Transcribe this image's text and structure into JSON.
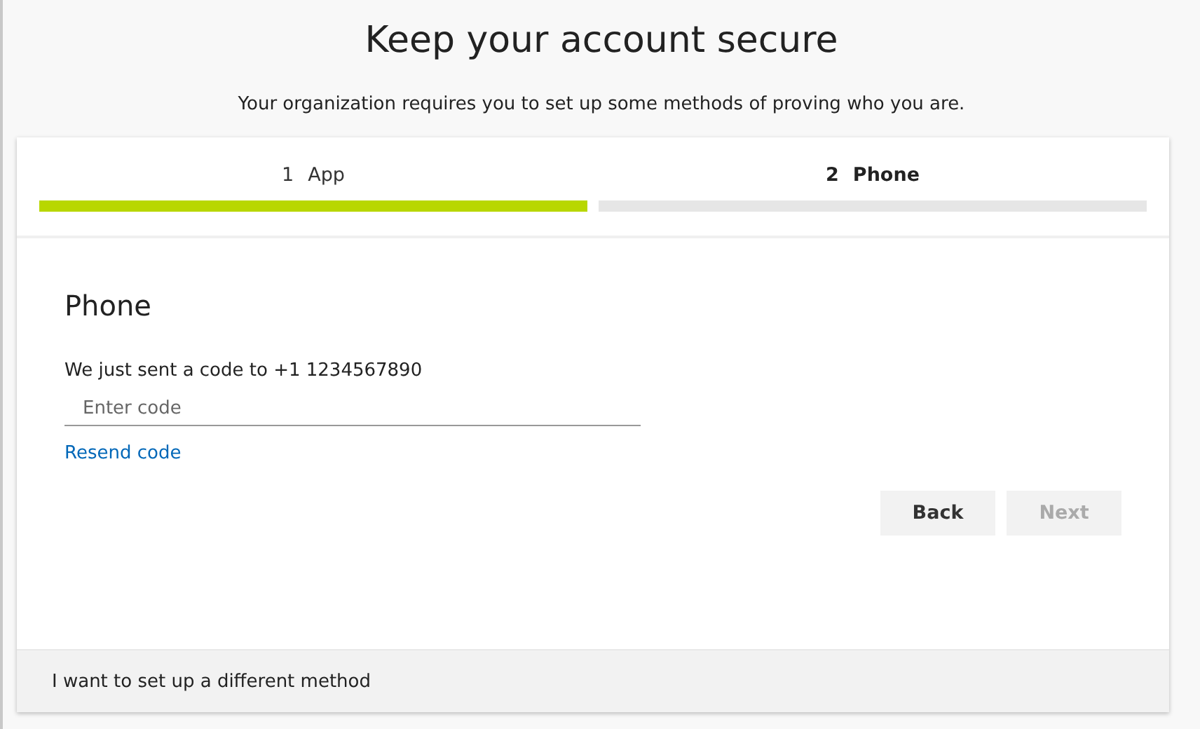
{
  "title": "Keep your account secure",
  "subtitle": "Your organization requires you to set up some methods of proving who you are.",
  "steps": [
    {
      "number": "1",
      "label": "App",
      "selected": false,
      "done": true
    },
    {
      "number": "2",
      "label": "Phone",
      "selected": true,
      "done": false
    }
  ],
  "section": {
    "heading": "Phone",
    "message": "We just sent a code to +1 1234567890",
    "code_field": {
      "placeholder": "Enter code"
    },
    "link": "Resend code"
  },
  "buttons": [
    {
      "label": "Back",
      "disabled": false
    },
    {
      "label": "Next",
      "disabled": true
    }
  ],
  "footer_link": "I want to set up a different method"
}
